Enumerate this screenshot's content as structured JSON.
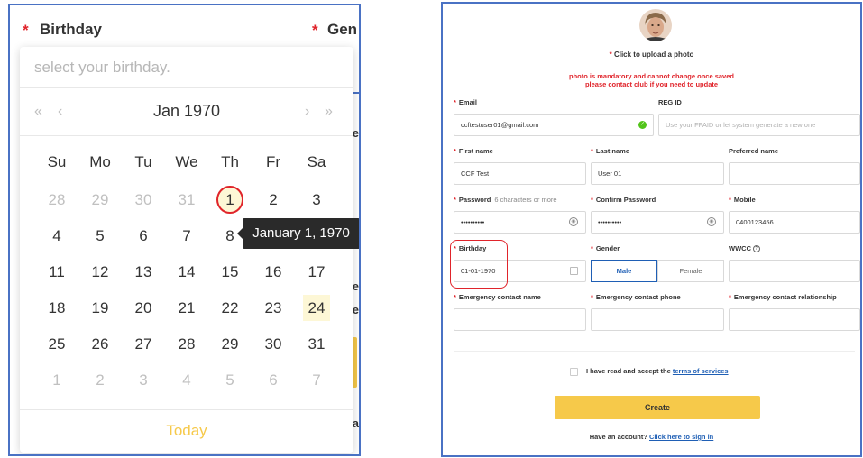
{
  "left": {
    "birthday_label": "Birthday",
    "gender_label_partial": "Gen",
    "behind_chars": [
      "e",
      "e",
      "e",
      "a"
    ],
    "picker": {
      "placeholder": "select your birthday.",
      "prev_year": "«",
      "prev_month": "‹",
      "next_month": "›",
      "next_year": "»",
      "month_title": "Jan 1970",
      "weekdays": [
        "Su",
        "Mo",
        "Tu",
        "We",
        "Th",
        "Fr",
        "Sa"
      ],
      "weeks": [
        [
          "28",
          "29",
          "30",
          "31",
          "1",
          "2",
          "3"
        ],
        [
          "4",
          "5",
          "6",
          "7",
          "8",
          "9",
          "10"
        ],
        [
          "11",
          "12",
          "13",
          "14",
          "15",
          "16",
          "17"
        ],
        [
          "18",
          "19",
          "20",
          "21",
          "22",
          "23",
          "24"
        ],
        [
          "25",
          "26",
          "27",
          "28",
          "29",
          "30",
          "31"
        ],
        [
          "1",
          "2",
          "3",
          "4",
          "5",
          "6",
          "7"
        ]
      ],
      "tooltip": "January 1, 1970",
      "today_label": "Today"
    }
  },
  "right": {
    "upload_text": "Click to upload a photo",
    "warning_line1": "photo is mandatory and cannot change once saved",
    "warning_line2": "please contact club if you need to update",
    "email_label": "Email",
    "email_value": "ccftestuser01@gmail.com",
    "regid_label": "REG ID",
    "regid_placeholder": "Use your FFAID or let system generate a new one",
    "firstname_label": "First name",
    "firstname_value": "CCF Test",
    "lastname_label": "Last name",
    "lastname_value": "User 01",
    "preferred_label": "Preferred name",
    "password_label": "Password",
    "password_hint": "6 characters or more",
    "password_value": "••••••••••",
    "confirm_label": "Confirm Password",
    "confirm_value": "••••••••••",
    "mobile_label": "Mobile",
    "mobile_value": "0400123456",
    "birthday_label": "Birthday",
    "birthday_value": "01-01-1970",
    "gender_label": "Gender",
    "gender_male": "Male",
    "gender_female": "Female",
    "wwcc_label": "WWCC",
    "ec_name_label": "Emergency contact name",
    "ec_phone_label": "Emergency contact phone",
    "ec_rel_label": "Emergency contact relationship",
    "terms_prefix": "I have read and accept the",
    "terms_link": "terms of services",
    "create_label": "Create",
    "signin_prefix": "Have an account?",
    "signin_link": "Click here to sign in"
  },
  "colors": {
    "accent_yellow": "#f6c94a",
    "required_red": "#e0242b",
    "link_blue": "#1f5fb5",
    "frame_blue": "#4a72c4",
    "today_bg": "#fdf7d6"
  }
}
